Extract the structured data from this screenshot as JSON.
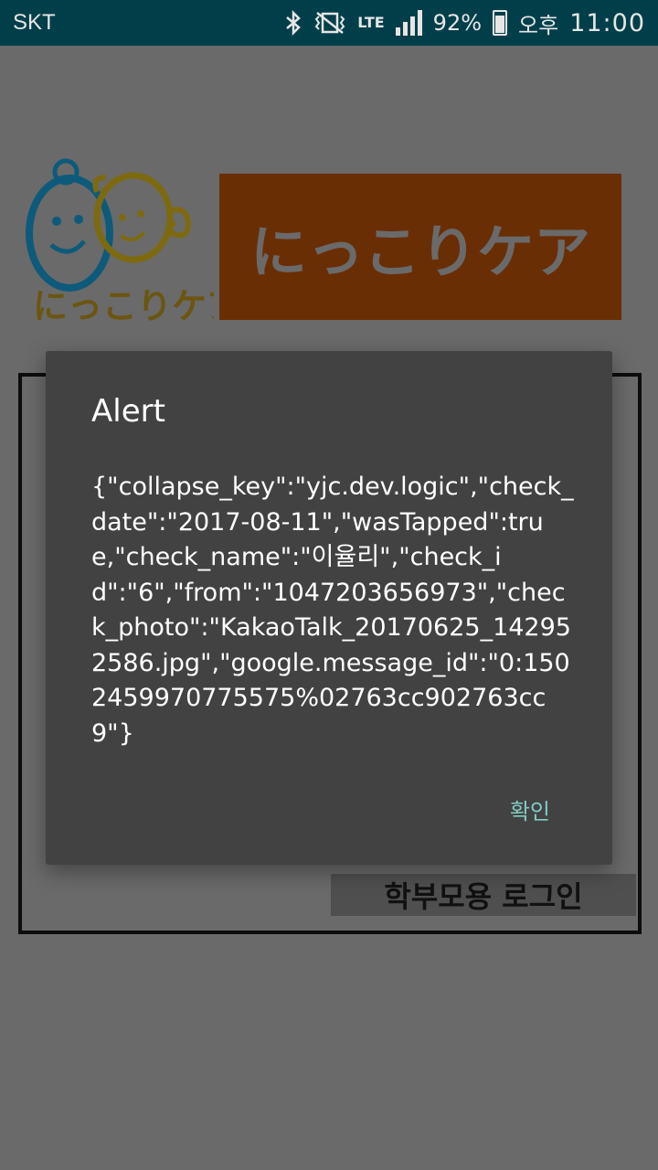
{
  "status_bar": {
    "carrier": "SKT",
    "lte_label": "LTE",
    "battery_percent": "92%",
    "ampm": "오후",
    "time": "11:00",
    "icons": [
      "bluetooth-icon",
      "vibrate-icon",
      "lte-icon",
      "signal-icon",
      "battery-charging-icon"
    ]
  },
  "app": {
    "logo_text": "にっこりケア",
    "banner_title": "にっこりケア",
    "parent_login_label": "학부모용 로그인",
    "banner_color": "#6a2e05",
    "background_color": "#6a6a6a"
  },
  "dialog": {
    "title": "Alert",
    "message": "{\"collapse_key\":\"yjc.dev.logic\",\"check_date\":\"2017-08-11\",\"wasTapped\":true,\"check_name\":\"이율리\",\"check_id\":\"6\",\"from\":\"1047203656973\",\"check_photo\":\"KakaoTalk_20170625_142952586.jpg\",\"google.message_id\":\"0:1502459970775575%02763cc902763cc9\"}",
    "ok_label": "확인",
    "accent_color": "#80cbc4"
  }
}
